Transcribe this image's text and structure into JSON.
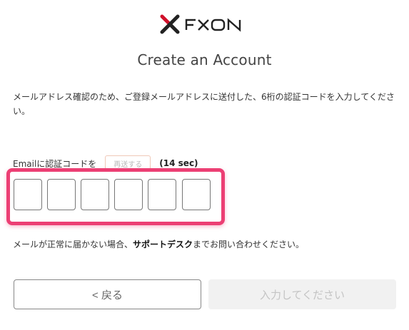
{
  "brand": {
    "name": "FXON",
    "accent": "#d0102a"
  },
  "page": {
    "title": "Create an Account"
  },
  "instructions": "メールアドレス確認のため、ご登録メールアドレスに送付した、6桁の認証コードを入力してください。",
  "code_section": {
    "label": "Emailに認証コードを",
    "resend_label": "再送する",
    "timer": "(14 sec)",
    "digits": [
      "",
      "",
      "",
      "",
      "",
      ""
    ],
    "highlight_color": "#ec3f74"
  },
  "help": {
    "prefix": "メールが正常に届かない場合、",
    "link": "サポートデスク",
    "suffix": "までお問い合わせください。"
  },
  "buttons": {
    "back": "< 戻る",
    "submit": "入力してください"
  }
}
